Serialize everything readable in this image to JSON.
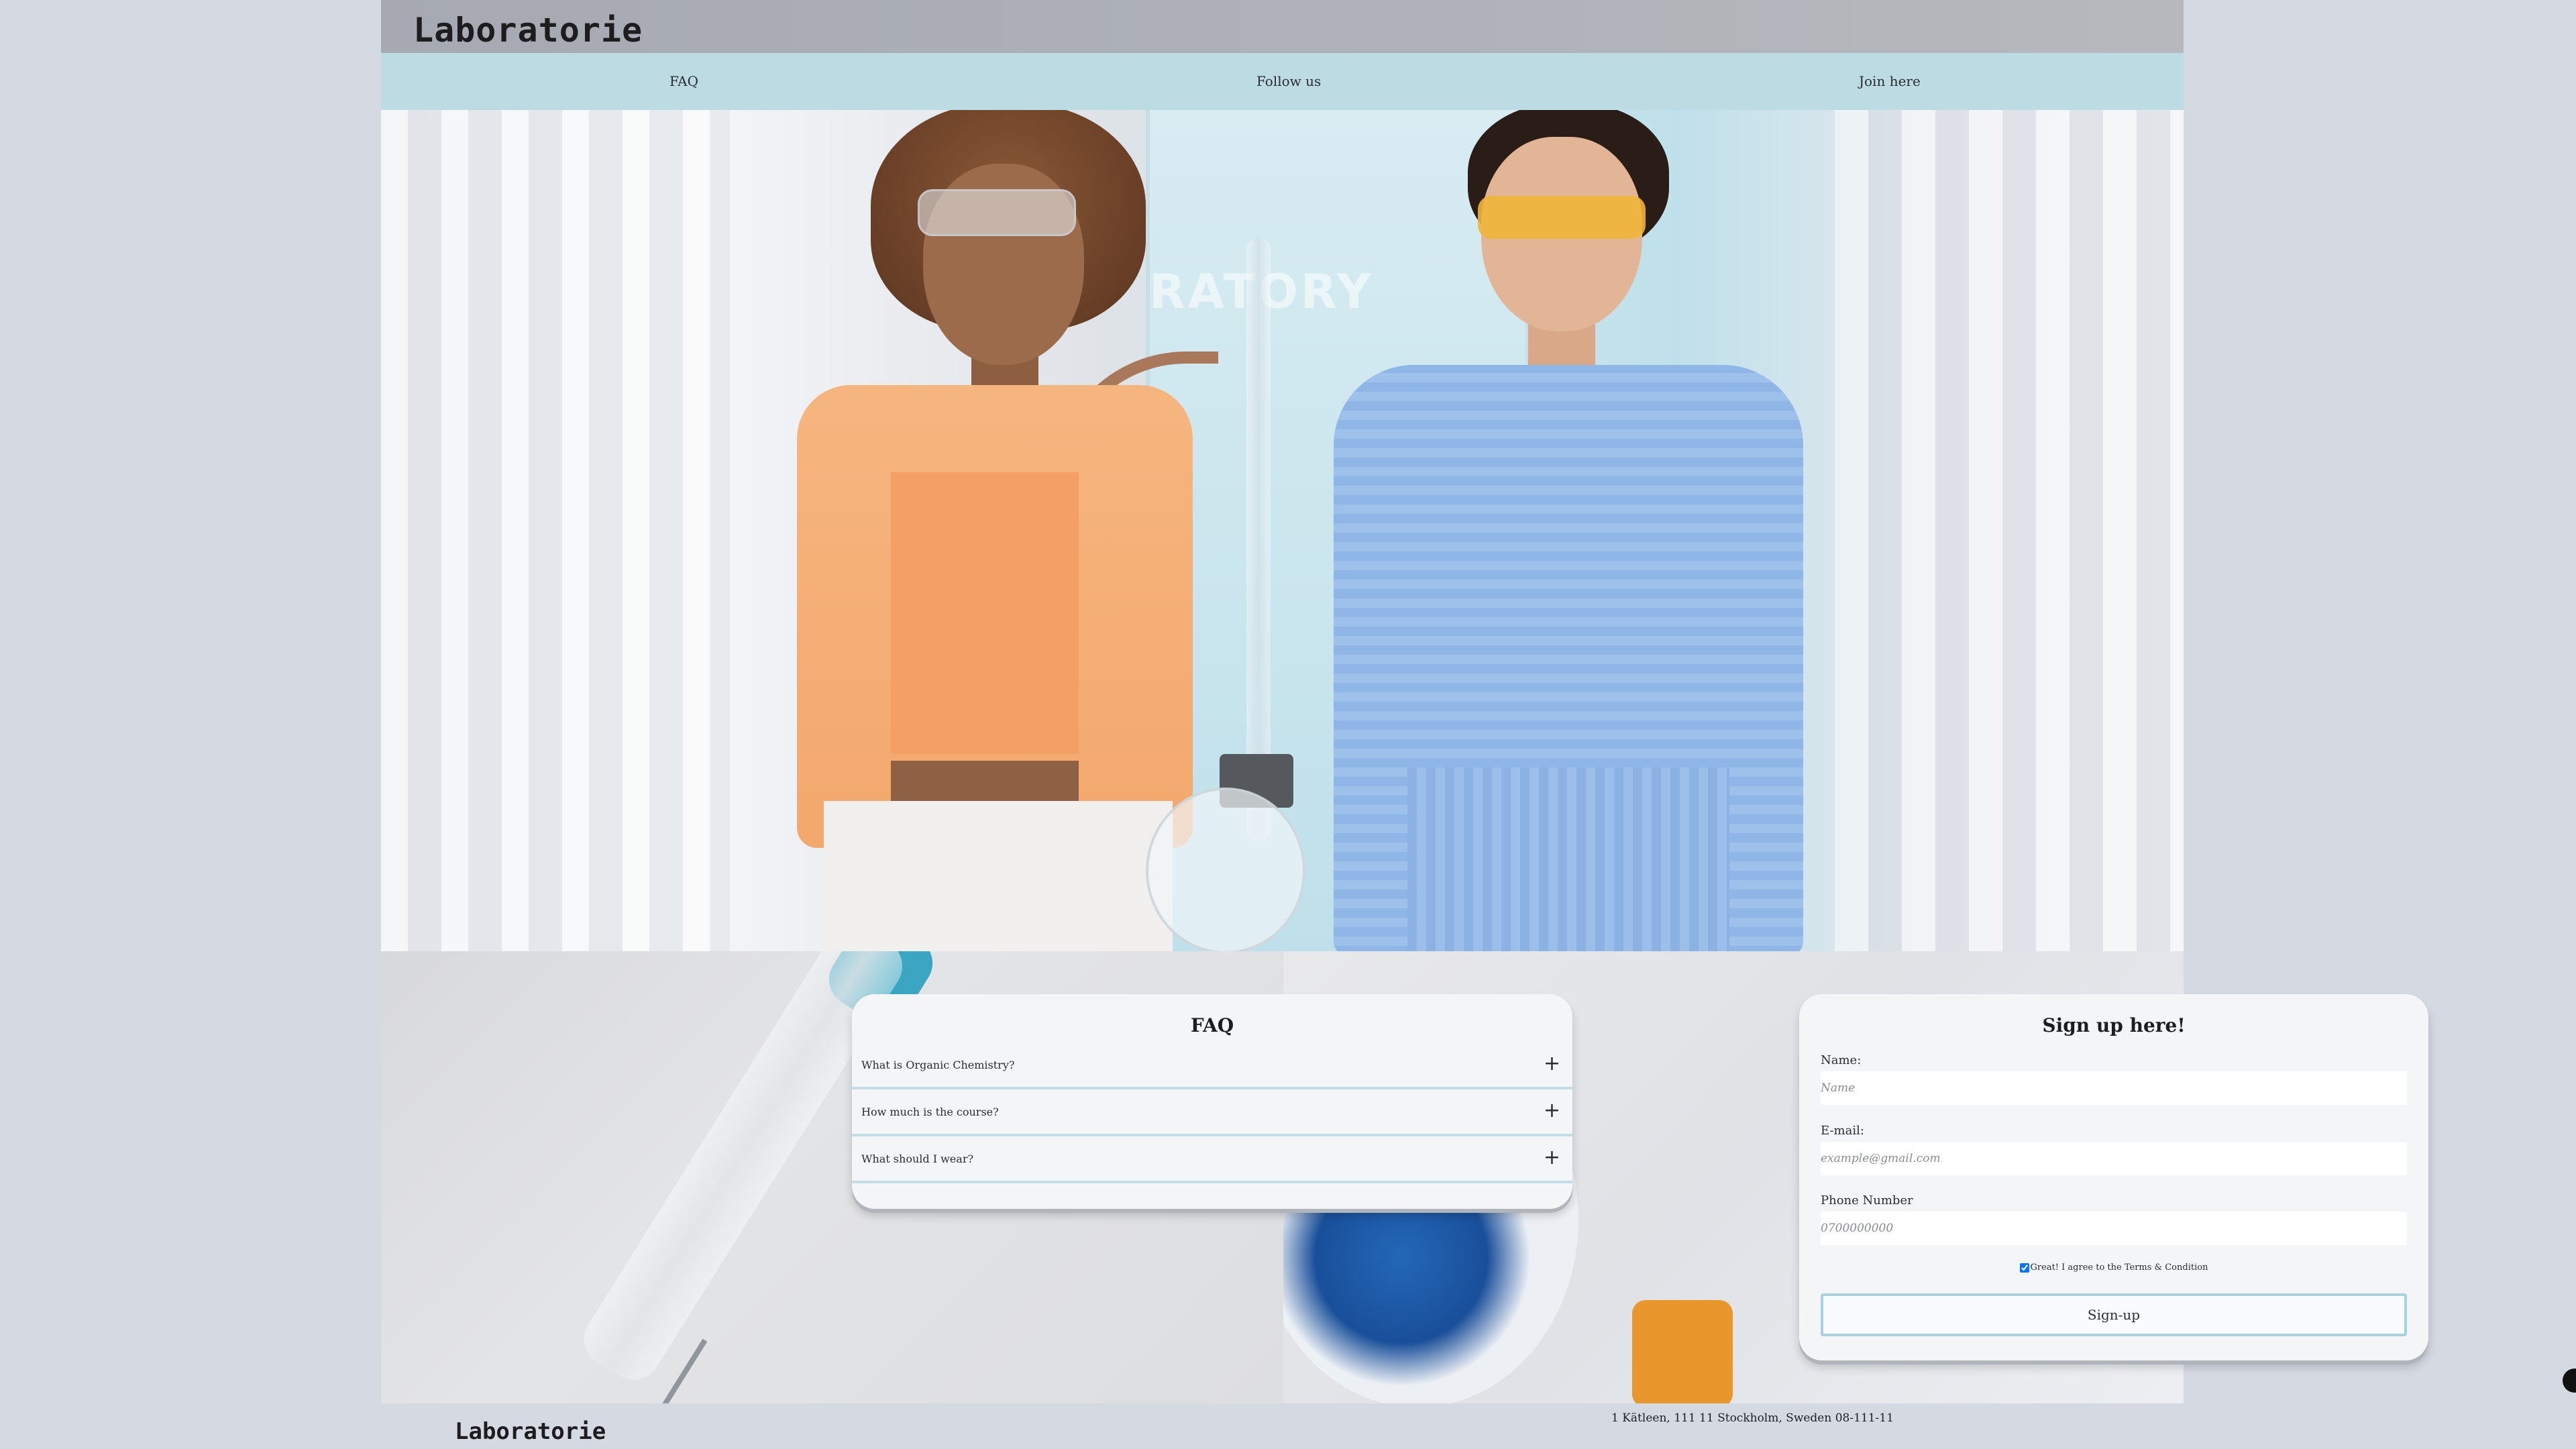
{
  "header": {
    "logo": "Laboratorie"
  },
  "nav": {
    "items": [
      "FAQ",
      "Follow us",
      "Join here"
    ]
  },
  "hero": {
    "background_text": "RATORY"
  },
  "faq": {
    "title": "FAQ",
    "items": [
      {
        "question": "What is Organic Chemistry?",
        "toggle": "+"
      },
      {
        "question": "How much is the course?",
        "toggle": "+"
      },
      {
        "question": "What should I wear?",
        "toggle": "+"
      }
    ]
  },
  "signup": {
    "title": "Sign up here!",
    "name_label": "Name:",
    "name_placeholder": "Name",
    "email_label": "E-mail:",
    "email_placeholder": "example@gmail.com",
    "phone_label": "Phone Number",
    "phone_placeholder": "0700000000",
    "terms_text": "Great! I agree to the Terms & Condition",
    "terms_checked": true,
    "button_label": "Sign-up"
  },
  "footer": {
    "logo": "Laboratorie",
    "address": "1 Kätleen, 111 11 Stockholm, Sweden 08-111-11"
  },
  "colors": {
    "nav_bg": "#bcdbe3",
    "page_bg": "#d5d9e2",
    "accent_border": "#a7d2dc"
  }
}
